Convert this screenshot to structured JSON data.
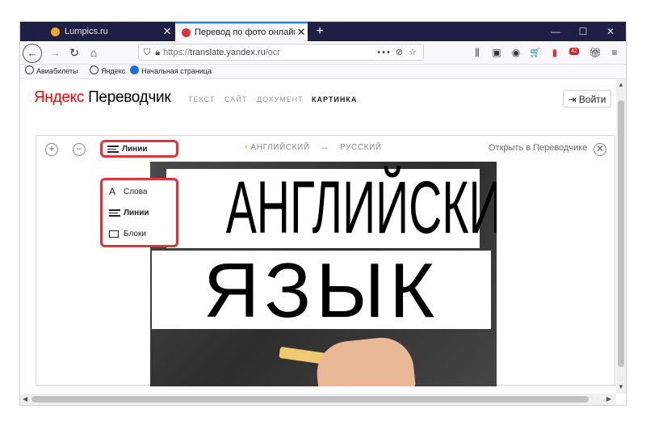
{
  "browser": {
    "tabs": [
      {
        "title": "Lumpics.ru",
        "close": "✕"
      },
      {
        "title": "Перевод по фото онлайн с ан",
        "close": "✕"
      }
    ],
    "new_tab": "+",
    "window_controls": {
      "minimize": "—",
      "maximize": "☐",
      "close": "✕"
    },
    "url_prefix": "https://",
    "url_host": "translate.yandex.ru",
    "url_path": "/ocr",
    "url_actions": "••• ⊘ ☆",
    "badge_count": "42",
    "bookmarks": [
      "Авиабилеты",
      "Яндекс",
      "Начальная страница"
    ]
  },
  "site": {
    "logo_brand": "Яндекс",
    "logo_product": " Переводчик",
    "nav": [
      "ТЕКСТ",
      "САЙТ",
      "ДОКУМЕНТ",
      "КАРТИНКА"
    ],
    "active_nav": "КАРТИНКА",
    "login_label": "Войти"
  },
  "workspace": {
    "zoom_in": "+",
    "zoom_out": "−",
    "source_lang": "АНГЛИЙСКИЙ",
    "swap_icon": "↔",
    "target_lang": "РУССКИЙ",
    "open_link": "Открыть в Переводчике",
    "close": "✕",
    "image_text_line1": "АНГЛИЙСКИЙ",
    "image_text_line2": "ЯЗЫК"
  },
  "mode_dropdown": {
    "selected": "Линии",
    "options": [
      {
        "label": "Слова",
        "icon": "letter-a-icon",
        "glyph": "A"
      },
      {
        "label": "Линии",
        "icon": "lines-icon",
        "bold": true
      },
      {
        "label": "Блоки",
        "icon": "box-icon"
      }
    ]
  },
  "colors": {
    "brand_red": "#ff0000",
    "highlight_red": "#e0323d",
    "tabbar": "#1f1f46",
    "accent_yellow": "#ffb200"
  }
}
